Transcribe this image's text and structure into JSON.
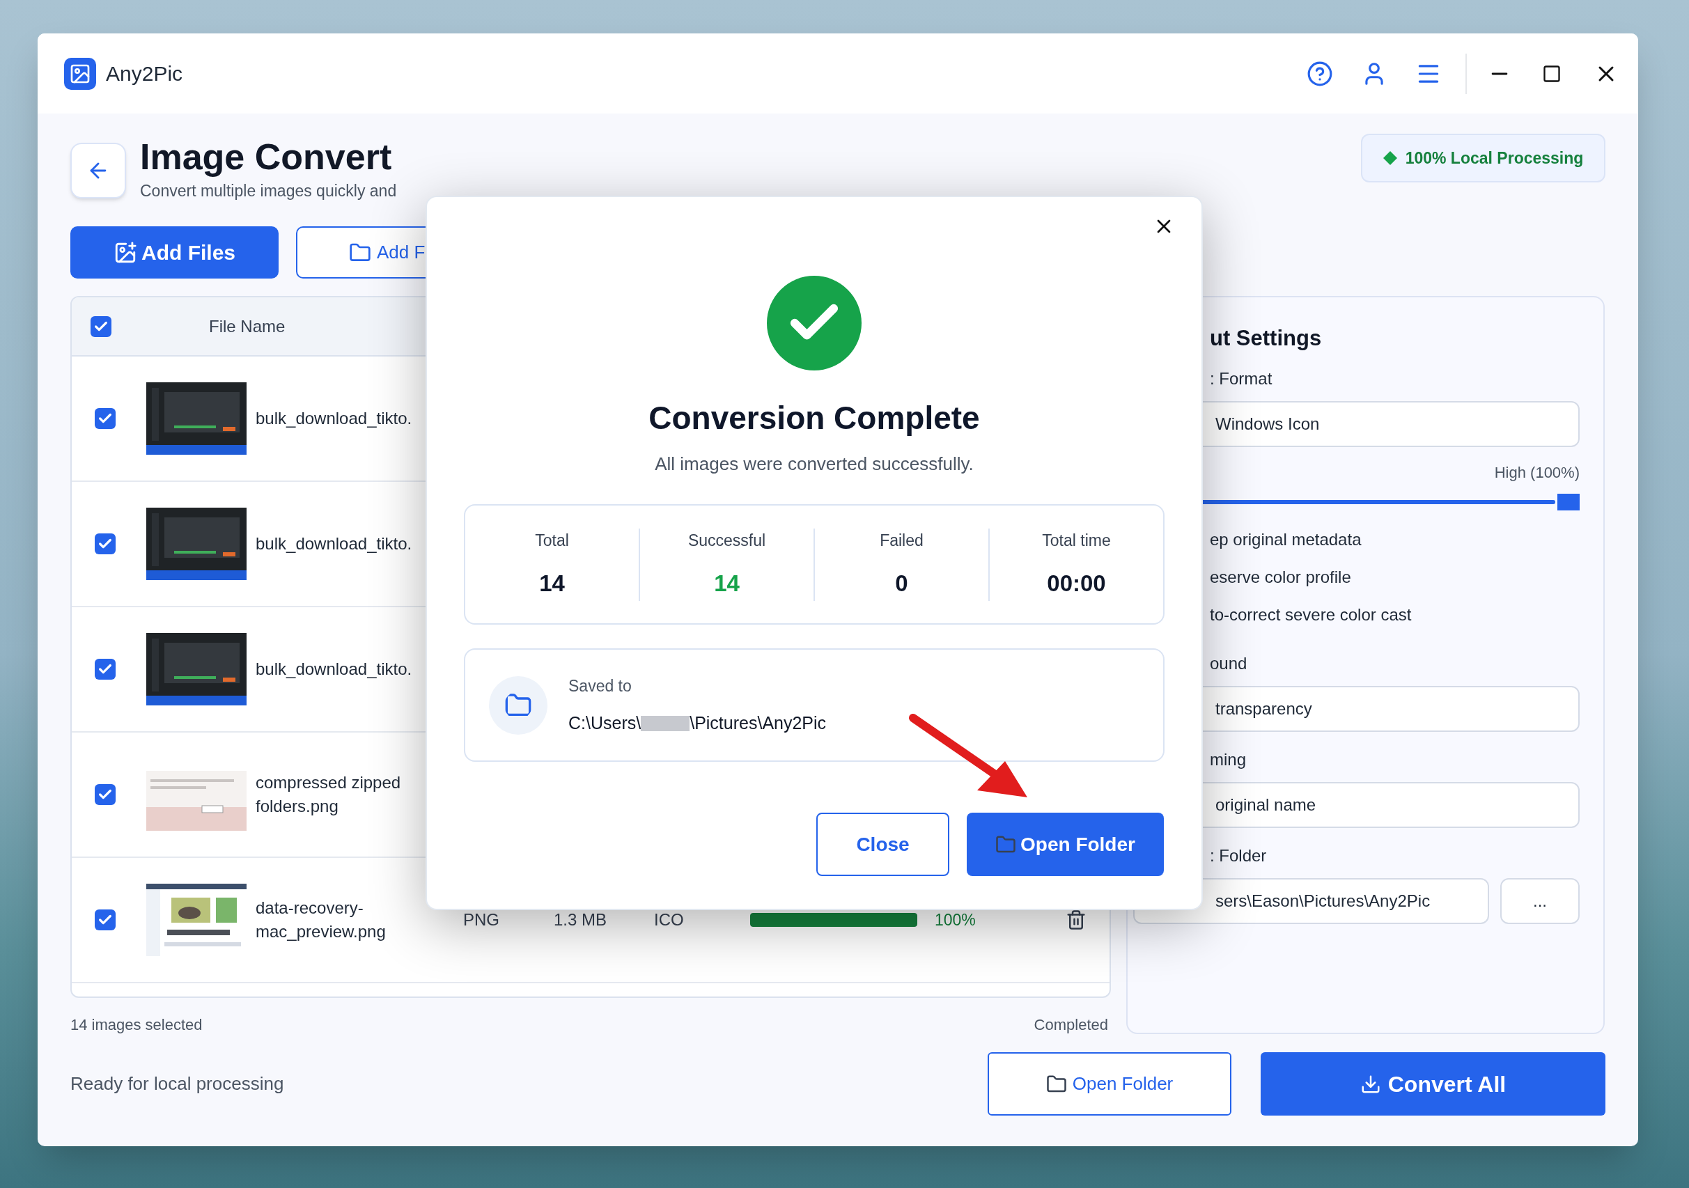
{
  "app": {
    "title": "Any2Pic"
  },
  "page": {
    "title": "Image Convert",
    "subtitle": "Convert multiple images quickly and",
    "badge": "100% Local Processing"
  },
  "toolbar": {
    "buttons": [
      {
        "label": "Add Files",
        "kind": "primary"
      },
      {
        "label": "Add F",
        "kind": "outline"
      }
    ]
  },
  "table": {
    "header": {
      "checked": true,
      "column": "File Name"
    },
    "rows": [
      {
        "checked": true,
        "name": "bulk_download_tikto."
      },
      {
        "checked": true,
        "name": "bulk_download_tikto."
      },
      {
        "checked": true,
        "name": "bulk_download_tikto."
      },
      {
        "checked": true,
        "name": "compressed zipped folders.png"
      },
      {
        "checked": true,
        "name": "data-recovery-mac_preview.png",
        "format": "PNG",
        "size": "1.3 MB",
        "target": "ICO",
        "level": 1,
        "progress": "100%"
      }
    ]
  },
  "footer": {
    "selected": "14 images selected",
    "status": "Completed"
  },
  "settings": {
    "title": "ut Settings",
    "format_label": ": Format",
    "format_value": "Windows Icon",
    "quality": {
      "value": "High (100%)",
      "level": 1
    },
    "options": [
      "ep original metadata",
      "eserve color profile",
      "to-correct severe color cast"
    ],
    "background_label": "ound",
    "background_value": "transparency",
    "naming_label": "ming",
    "naming_value": "original name",
    "folder_label": ": Folder",
    "folder_value": "sers\\Eason\\Pictures\\Any2Pic",
    "browse": "..."
  },
  "status_bar": {
    "text": "Ready for local processing",
    "buttons": [
      {
        "label": "Open Folder",
        "kind": "outline"
      },
      {
        "label": "Convert All",
        "kind": "primary"
      }
    ]
  },
  "dialog": {
    "title": "Conversion Complete",
    "message": "All images were converted successfully.",
    "stats": [
      {
        "label": "Total",
        "value": "14",
        "color": "#0f172a"
      },
      {
        "label": "Successful",
        "value": "14",
        "color": "#16a34a"
      },
      {
        "label": "Failed",
        "value": "0",
        "color": "#0f172a"
      },
      {
        "label": "Total time",
        "value": "00:00",
        "color": "#0f172a"
      }
    ],
    "saved_label": "Saved to",
    "path_before": "C:\\Users\\",
    "path_after": "\\Pictures\\Any2Pic",
    "buttons": [
      {
        "label": "Close",
        "kind": "outline"
      },
      {
        "label": "Open Folder",
        "kind": "primary"
      }
    ]
  }
}
